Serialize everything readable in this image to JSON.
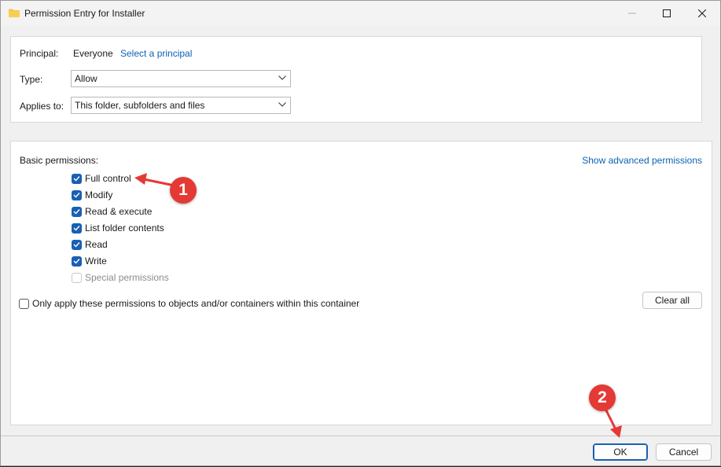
{
  "window": {
    "title": "Permission Entry for Installer",
    "icon": "folder-icon"
  },
  "principal": {
    "label": "Principal:",
    "value": "Everyone",
    "link": "Select a principal"
  },
  "type": {
    "label": "Type:",
    "value": "Allow"
  },
  "applies_to": {
    "label": "Applies to:",
    "value": "This folder, subfolders and files"
  },
  "permissions": {
    "heading": "Basic permissions:",
    "advanced_link": "Show advanced permissions",
    "items": [
      {
        "label": "Full control",
        "checked": true,
        "disabled": false
      },
      {
        "label": "Modify",
        "checked": true,
        "disabled": false
      },
      {
        "label": "Read & execute",
        "checked": true,
        "disabled": false
      },
      {
        "label": "List folder contents",
        "checked": true,
        "disabled": false
      },
      {
        "label": "Read",
        "checked": true,
        "disabled": false
      },
      {
        "label": "Write",
        "checked": true,
        "disabled": false
      },
      {
        "label": "Special permissions",
        "checked": false,
        "disabled": true
      }
    ],
    "only_apply_label": "Only apply these permissions to objects and/or containers within this container",
    "only_apply_checked": false,
    "clear_all_label": "Clear all"
  },
  "footer": {
    "ok_label": "OK",
    "cancel_label": "Cancel"
  },
  "annotations": [
    {
      "number": "1",
      "color": "#e53935"
    },
    {
      "number": "2",
      "color": "#e53935"
    }
  ],
  "colors": {
    "accent": "#1a5fb4",
    "link": "#0b62b3",
    "annotation": "#e53935",
    "folder": "#f4c542"
  }
}
